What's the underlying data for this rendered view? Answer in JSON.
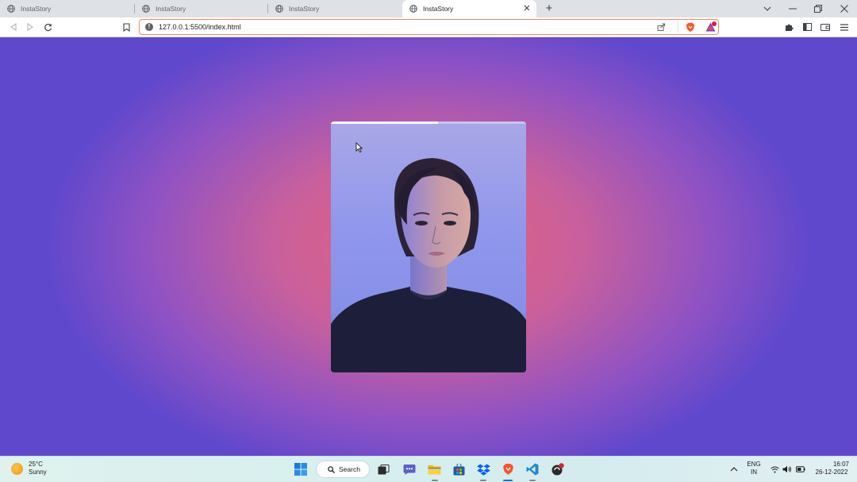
{
  "browser": {
    "tabs": [
      {
        "title": "InstaStory",
        "active": false
      },
      {
        "title": "InstaStory",
        "active": false
      },
      {
        "title": "InstaStory",
        "active": false
      },
      {
        "title": "InstaStory",
        "active": true
      }
    ],
    "address": {
      "url": "127.0.0.1:5500/index.html"
    }
  },
  "story": {
    "progress_percent": 55,
    "image_icon": "woman-portrait-photo"
  },
  "taskbar": {
    "weather": {
      "temp": "25°C",
      "condition": "Sunny"
    },
    "search_label": "Search",
    "language": {
      "line1": "ENG",
      "line2": "IN"
    },
    "clock": {
      "time": "16:07",
      "date": "26-12-2022"
    }
  },
  "colors": {
    "page_gradient_center": "#e5607a",
    "page_gradient_edge": "#6048cc",
    "omnibox_border": "#f08a5d",
    "brave_orange": "#fb542b"
  }
}
